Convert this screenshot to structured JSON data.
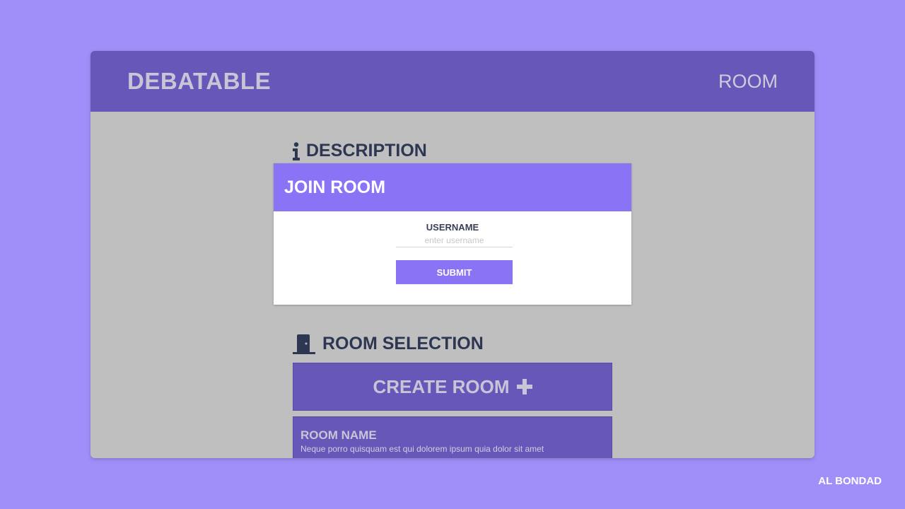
{
  "header": {
    "brand": "DEBATABLE",
    "nav_room": "ROOM"
  },
  "description": {
    "heading": "DESCRIPTION",
    "icon": "info-icon"
  },
  "join_room": {
    "title": "JOIN ROOM",
    "username_label": "USERNAME",
    "username_placeholder": "enter username",
    "username_value": "",
    "submit_label": "SUBMIT"
  },
  "room_selection": {
    "heading": "ROOM SELECTION",
    "icon": "door-icon",
    "create_label": "CREATE ROOM",
    "create_icon": "plus-icon",
    "rooms": [
      {
        "name": "ROOM NAME",
        "description": "Neque porro quisquam est qui dolorem ipsum quia dolor sit amet"
      }
    ]
  },
  "watermark": "AL BONDAD",
  "colors": {
    "page_bg": "#a18ff9",
    "header_bg": "#6757b9",
    "content_bg": "#bfbfbf",
    "accent": "#8b73f6",
    "heading_text": "#2e3752"
  }
}
